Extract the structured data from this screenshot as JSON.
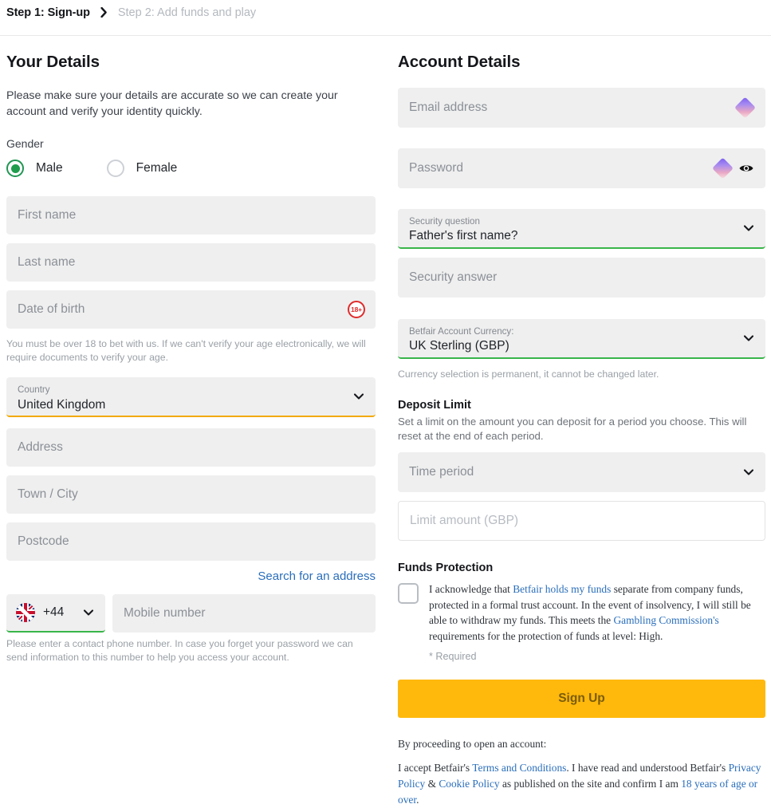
{
  "breadcrumb": {
    "step1": "Step 1: Sign-up",
    "separator": "›",
    "step2": "Step 2: Add funds and play"
  },
  "left": {
    "title": "Your Details",
    "intro": "Please make sure your details are accurate so we can create your account and verify your identity quickly.",
    "gender_label": "Gender",
    "gender": {
      "male": "Male",
      "female": "Female",
      "selected": "Male"
    },
    "first_name_placeholder": "First name",
    "last_name_placeholder": "Last name",
    "dob_placeholder": "Date of birth",
    "dob_badge": "18+",
    "dob_helper": "You must be over 18 to bet with us. If we can't verify your age electronically, we will require documents to verify your age.",
    "country_label": "Country",
    "country_value": "United Kingdom",
    "address_placeholder": "Address",
    "town_placeholder": "Town / City",
    "postcode_placeholder": "Postcode",
    "search_address_link": "Search for an address",
    "phone_prefix": "+44",
    "mobile_placeholder": "Mobile number",
    "phone_helper": "Please enter a contact phone number. In case you forget your password we can send information to this number to help you access your account."
  },
  "right": {
    "title": "Account Details",
    "email_placeholder": "Email address",
    "password_placeholder": "Password",
    "security_question_label": "Security question",
    "security_question_value": "Father's first name?",
    "security_answer_placeholder": "Security answer",
    "currency_label": "Betfair Account Currency:",
    "currency_value": "UK Sterling (GBP)",
    "currency_helper": "Currency selection is permanent, it cannot be changed later.",
    "deposit_limit_title": "Deposit Limit",
    "deposit_limit_desc": "Set a limit on the amount you can deposit for a period you choose. This will reset at the end of each period.",
    "time_period_placeholder": "Time period",
    "limit_amount_placeholder": "Limit amount (GBP)",
    "funds_protection_title": "Funds Protection",
    "funds_text_1": "I acknowledge that ",
    "funds_link_1": "Betfair holds my funds",
    "funds_text_2": " separate from company funds, protected in a formal trust account. In the event of insolvency, I will still be able to withdraw my funds. This meets the ",
    "funds_link_2": "Gambling Commission's",
    "funds_text_3": " requirements for the protection of funds at level: High.",
    "required_note": "* Required",
    "signup_label": "Sign Up",
    "footer_intro": "By proceeding to open an account:",
    "footer_text_1": "I accept Betfair's ",
    "footer_link_terms": "Terms and Conditions",
    "footer_text_2": ". I have read and understood Betfair's ",
    "footer_link_privacy": "Privacy Policy",
    "footer_amp": " & ",
    "footer_link_cookie": "Cookie Policy",
    "footer_text_3": " as published on the site and confirm I am ",
    "footer_link_age": "18 years of age or over",
    "footer_text_4": "."
  },
  "colors": {
    "accent_yellow": "#FFB80C",
    "link_blue": "#2a6ebb",
    "valid_green": "#39b54a",
    "amber_underline": "#f2a900",
    "field_bg": "#efefef",
    "badge_red": "#e02b2b"
  }
}
